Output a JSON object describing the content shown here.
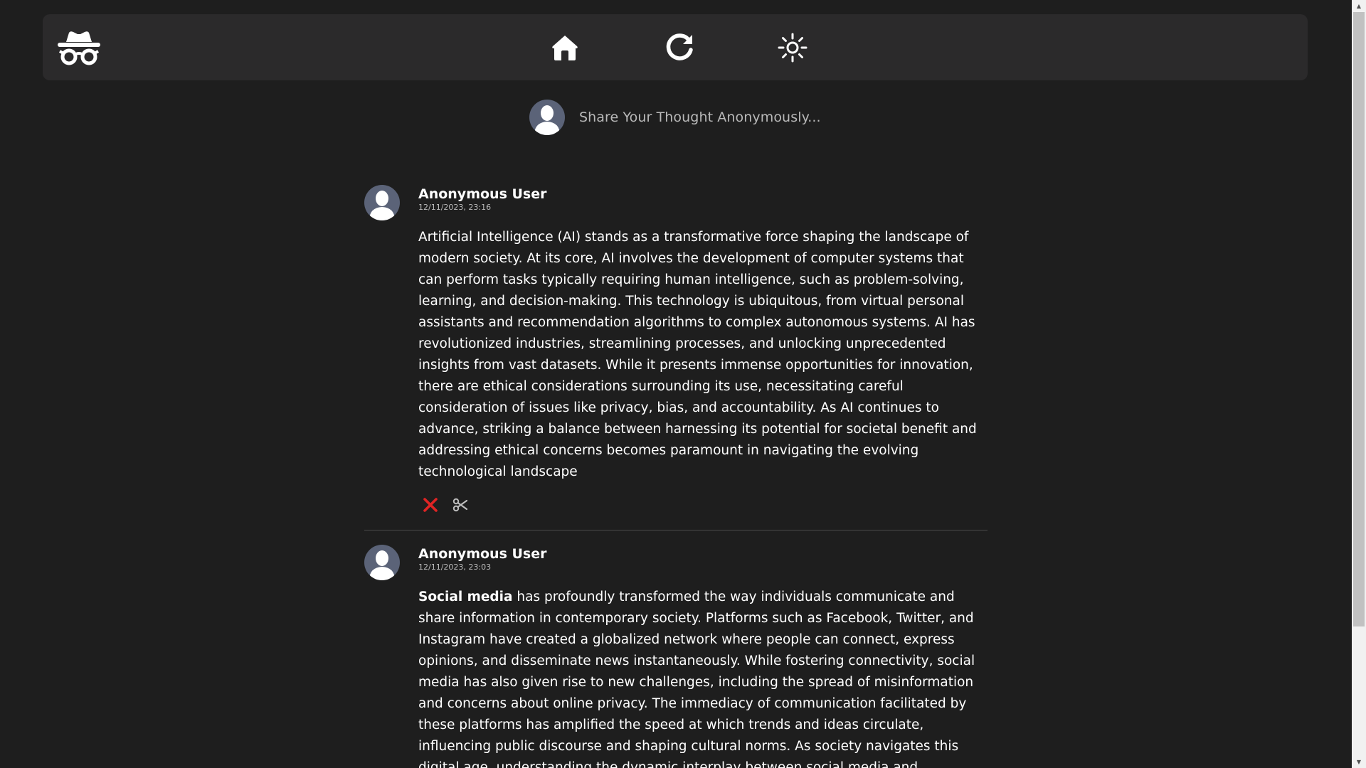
{
  "navbar": {
    "logo_icon": "incognito-icon",
    "home_icon": "home-icon",
    "refresh_icon": "refresh-icon",
    "theme_icon": "sun-icon"
  },
  "composer": {
    "placeholder": "Share Your Thought Anonymously..."
  },
  "posts": [
    {
      "author": "Anonymous User",
      "timestamp": "12/11/2023, 23:16",
      "body_bold": "",
      "body": "Artificial Intelligence (AI) stands as a transformative force shaping the landscape of modern society. At its core, AI involves the development of computer systems that can perform tasks typically requiring human intelligence, such as problem-solving, learning, and decision-making. This technology is ubiquitous, from virtual personal assistants and recommendation algorithms to complex autonomous systems. AI has revolutionized industries, streamlining processes, and unlocking unprecedented insights from vast datasets. While it presents immense opportunities for innovation, there are ethical considerations surrounding its use, necessitating careful consideration of issues like privacy, bias, and accountability. As AI continues to advance, striking a balance between harnessing its potential for societal benefit and addressing ethical concerns becomes paramount in navigating the evolving technological landscape",
      "actions": [
        "delete-icon",
        "scissors-icon"
      ]
    },
    {
      "author": "Anonymous User",
      "timestamp": "12/11/2023, 23:03",
      "body_bold": "Social media",
      "body": " has profoundly transformed the way individuals communicate and share information in contemporary society. Platforms such as Facebook, Twitter, and Instagram have created a globalized network where people can connect, express opinions, and disseminate news instantaneously. While fostering connectivity, social media has also given rise to new challenges, including the spread of misinformation and concerns about online privacy. The immediacy of communication facilitated by these platforms has amplified the speed at which trends and ideas circulate, influencing public discourse and shaping cultural norms. As society navigates this digital age, understanding the dynamic interplay between social media and communication is crucial"
    }
  ],
  "colors": {
    "background": "#1e1e1e",
    "navbar": "#2b2a2b",
    "avatar": "#5b6378",
    "delete": "#e02424",
    "scissors": "#bdbdbd"
  }
}
